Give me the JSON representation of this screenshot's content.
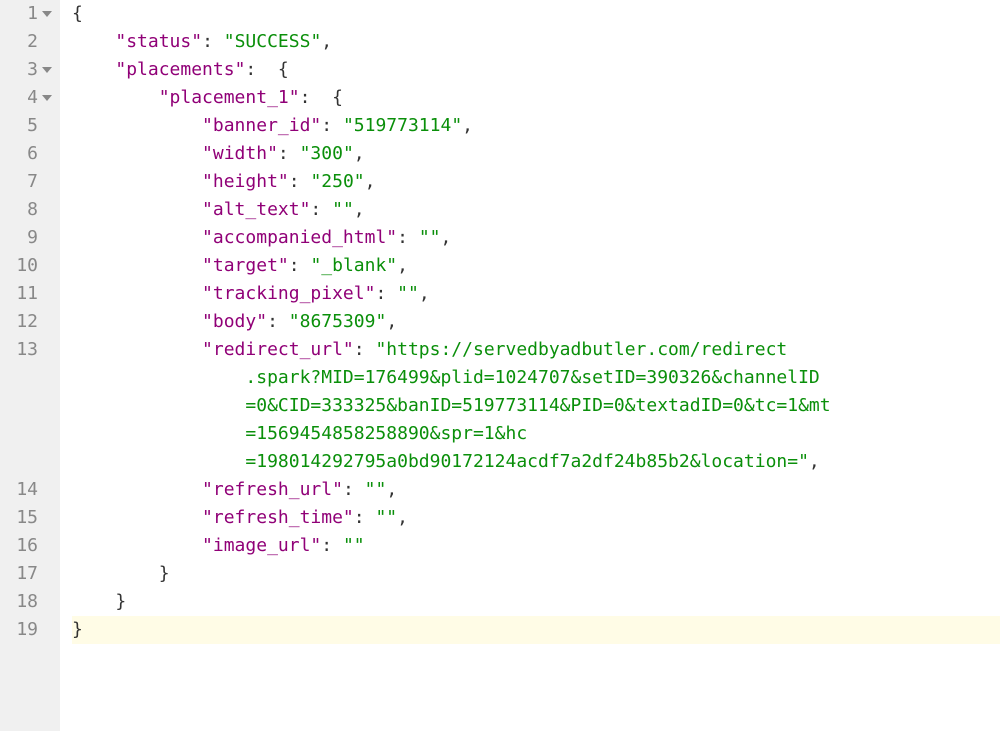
{
  "gutter": {
    "numbers": [
      "1",
      "2",
      "3",
      "4",
      "5",
      "6",
      "7",
      "8",
      "9",
      "10",
      "11",
      "12",
      "13",
      "14",
      "15",
      "16",
      "17",
      "18",
      "19"
    ],
    "fold_lines": [
      0,
      2,
      3
    ]
  },
  "code": {
    "ln1": "{",
    "ln2_key": "\"status\"",
    "ln2_val": "\"SUCCESS\"",
    "ln3_key": "\"placements\"",
    "ln4_key": "\"placement_1\"",
    "ln5_key": "\"banner_id\"",
    "ln5_val": "\"519773114\"",
    "ln6_key": "\"width\"",
    "ln6_val": "\"300\"",
    "ln7_key": "\"height\"",
    "ln7_val": "\"250\"",
    "ln8_key": "\"alt_text\"",
    "ln8_val": "\"\"",
    "ln9_key": "\"accompanied_html\"",
    "ln9_val": "\"\"",
    "ln10_key": "\"target\"",
    "ln10_val": "\"_blank\"",
    "ln11_key": "\"tracking_pixel\"",
    "ln11_val": "\"\"",
    "ln12_key": "\"body\"",
    "ln12_val": "\"8675309\"",
    "ln13_key": "\"redirect_url\"",
    "ln13_val_1": "\"https://servedbyadbutler.com/redirect",
    "ln13_val_2": ".spark?MID=176499&plid=1024707&setID=390326&channelID",
    "ln13_val_3": "=0&CID=333325&banID=519773114&PID=0&textadID=0&tc=1&mt",
    "ln13_val_4": "=1569454858258890&spr=1&hc",
    "ln13_val_5": "=198014292795a0bd90172124acdf7a2df24b85b2&location=\"",
    "ln14_key": "\"refresh_url\"",
    "ln14_val": "\"\"",
    "ln15_key": "\"refresh_time\"",
    "ln15_val": "\"\"",
    "ln16_key": "\"image_url\"",
    "ln16_val": "\"\"",
    "indent_1": "    ",
    "indent_2": "        ",
    "indent_3": "            ",
    "wrap_indent": "                ",
    "colon": ": ",
    "comma": ",",
    "open_brace": "{",
    "close_brace": "}",
    "colon_brace": ":  {"
  }
}
